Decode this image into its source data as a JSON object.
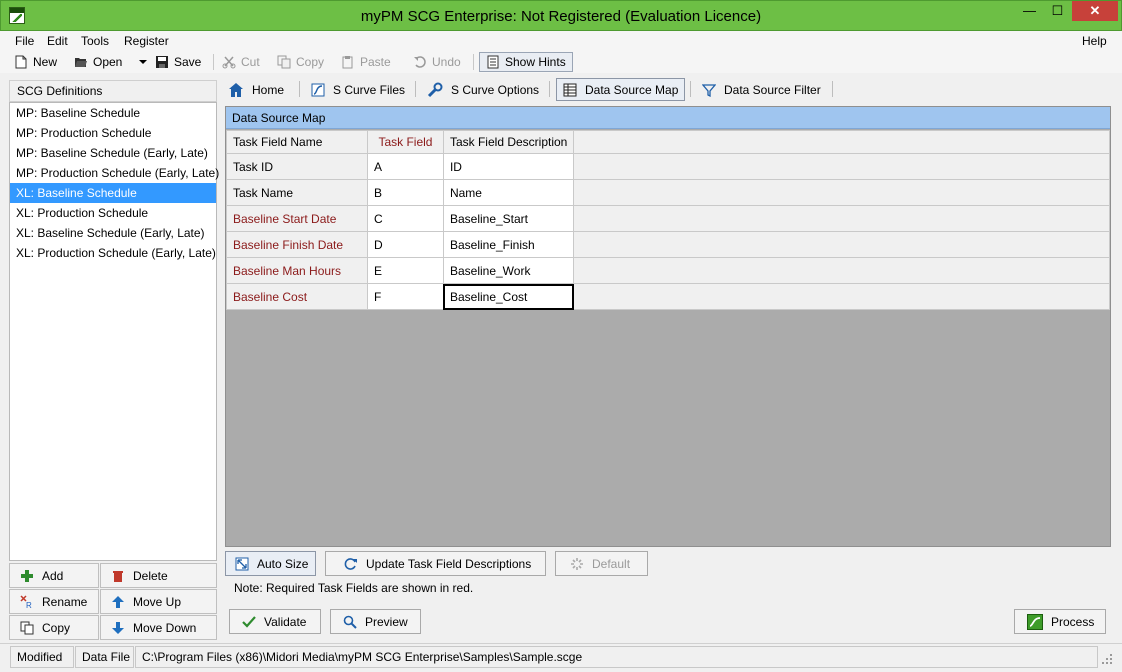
{
  "window": {
    "title": "myPM SCG Enterprise: Not Registered (Evaluation Licence)",
    "icon_label": "SCGE",
    "min_symbol": "—",
    "max_symbol": "☐",
    "close_symbol": "✕"
  },
  "menu": {
    "file": "File",
    "edit": "Edit",
    "tools": "Tools",
    "register": "Register",
    "help": "Help"
  },
  "toolbar": {
    "new": "New",
    "open": "Open",
    "save": "Save",
    "cut": "Cut",
    "copy": "Copy",
    "paste": "Paste",
    "undo": "Undo",
    "show_hints": "Show Hints"
  },
  "left": {
    "header": "SCG Definitions",
    "items": [
      "MP: Baseline Schedule",
      "MP: Production Schedule",
      "MP: Baseline Schedule (Early, Late)",
      "MP: Production Schedule (Early, Late)",
      "XL: Baseline Schedule",
      "XL: Production Schedule",
      "XL: Baseline Schedule (Early, Late)",
      "XL: Production Schedule (Early, Late)"
    ],
    "selected_index": 4,
    "buttons": {
      "add": "Add",
      "delete": "Delete",
      "rename": "Rename",
      "move_up": "Move Up",
      "copy": "Copy",
      "move_down": "Move Down"
    }
  },
  "tabs": {
    "home": "Home",
    "s_curve_files": "S Curve Files",
    "s_curve_options": "S Curve Options",
    "data_source_map": "Data Source Map",
    "data_source_filter": "Data Source Filter"
  },
  "panel": {
    "title": "Data Source Map",
    "headers": {
      "name": "Task Field Name",
      "field": "Task Field",
      "desc": "Task Field Description"
    },
    "rows": [
      {
        "name": "Task ID",
        "field": "A",
        "desc": "ID",
        "required": false
      },
      {
        "name": "Task Name",
        "field": "B",
        "desc": "Name",
        "required": false
      },
      {
        "name": "Baseline Start Date",
        "field": "C",
        "desc": "Baseline_Start",
        "required": true
      },
      {
        "name": "Baseline Finish Date",
        "field": "D",
        "desc": "Baseline_Finish",
        "required": true
      },
      {
        "name": "Baseline Man Hours",
        "field": "E",
        "desc": "Baseline_Work",
        "required": true
      },
      {
        "name": "Baseline Cost",
        "field": "F",
        "desc": "Baseline_Cost",
        "required": true
      }
    ]
  },
  "actions": {
    "auto_size": "Auto Size",
    "update_desc": "Update Task Field Descriptions",
    "default": "Default",
    "note": "Note: Required Task Fields are shown in red.",
    "validate": "Validate",
    "preview": "Preview",
    "process": "Process"
  },
  "status": {
    "modified": "Modified",
    "data_file_label": "Data File",
    "path": "C:\\Program Files (x86)\\Midori Media\\myPM SCG Enterprise\\Samples\\Sample.scge"
  },
  "colors": {
    "titlebar": "#6dbf45",
    "selection": "#3399ff",
    "required_text": "#8b1a1a",
    "panel_header": "#9fc5ef"
  }
}
